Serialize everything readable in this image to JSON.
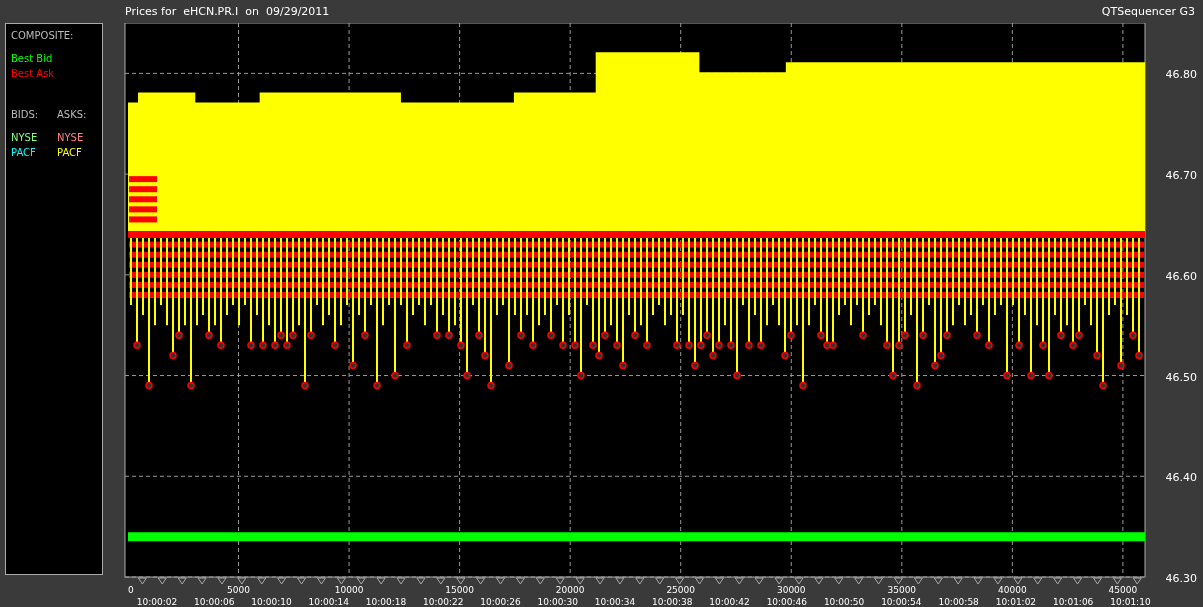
{
  "header": {
    "title": "Prices for  eHCN.PR.I  on  09/29/2011",
    "app_name": "QTSequencer G3"
  },
  "legend": {
    "composite_heading": "COMPOSITE:",
    "composite": [
      {
        "label": "Best Bid",
        "color": "#00ff00"
      },
      {
        "label": "Best Ask",
        "color": "#ff0000"
      }
    ],
    "bids_heading": "BIDS:",
    "asks_heading": "ASKS:",
    "bids": [
      {
        "label": "NYSE",
        "color": "#80ff80"
      },
      {
        "label": "PACF",
        "color": "#00ffff"
      }
    ],
    "asks": [
      {
        "label": "NYSE",
        "color": "#ff8080"
      },
      {
        "label": "PACF",
        "color": "#ffff00"
      }
    ]
  },
  "chart": {
    "time_labels": [
      "10:00:02",
      "10:00:06",
      "10:00:10",
      "10:00:14",
      "10:00:18",
      "10:00:22",
      "10:00:26",
      "10:00:30",
      "10:00:34",
      "10:00:38",
      "10:00:42",
      "10:00:46",
      "10:00:50",
      "10:00:54",
      "10:00:58",
      "10:01:02",
      "10:01:06",
      "10:01:10"
    ],
    "chart_data": {
      "type": "line",
      "x": [
        0,
        500,
        500,
        3000,
        3000,
        6000,
        6000,
        12300,
        12300,
        17500,
        17500,
        21200,
        21200,
        25800,
        25800,
        29800,
        29800,
        46000
      ],
      "series": [
        {
          "color": "#ffff00",
          "values": [
            46.77,
            46.77,
            46.78,
            46.78,
            46.77,
            46.77,
            46.78,
            46.78,
            46.77,
            46.77,
            46.78,
            46.78,
            46.82,
            46.82,
            46.8,
            46.8,
            46.81,
            46.81
          ]
        },
        {
          "color": "#ff0000",
          "values": [
            46.64,
            46.64,
            46.64,
            46.64,
            46.64,
            46.64,
            46.64,
            46.64,
            46.64,
            46.64,
            46.64,
            46.64,
            46.64,
            46.64,
            46.64,
            46.64,
            46.64,
            46.64
          ]
        },
        {
          "color": "#00ff00",
          "values": [
            46.34,
            46.34,
            46.34,
            46.34,
            46.34,
            46.34,
            46.34,
            46.34,
            46.34,
            46.34,
            46.34,
            46.34,
            46.34,
            46.34,
            46.34,
            46.34,
            46.34,
            46.34
          ]
        }
      ],
      "grid": true,
      "xlim": [
        0,
        46000
      ],
      "ylim": [
        46.3,
        46.85
      ],
      "xticks": [
        0,
        5000,
        10000,
        15000,
        20000,
        25000,
        30000,
        35000,
        40000,
        45000
      ],
      "yticks": [
        {
          "value": 46.3,
          "label": "46.30"
        },
        {
          "value": 46.4,
          "label": "46.40"
        },
        {
          "value": 46.5,
          "label": "46.50"
        },
        {
          "value": 46.6,
          "label": "46.60"
        },
        {
          "value": 46.7,
          "label": "46.70"
        },
        {
          "value": 46.8,
          "label": "46.80"
        }
      ]
    }
  }
}
